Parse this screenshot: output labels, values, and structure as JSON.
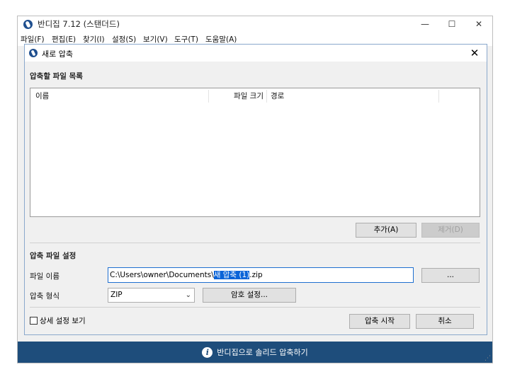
{
  "app": {
    "title": "반디집 7.12 (스탠더드)",
    "min_glyph": "—",
    "max_glyph": "☐",
    "close_glyph": "✕"
  },
  "menu": [
    "파일(F)",
    "편집(E)",
    "찾기(I)",
    "설정(S)",
    "보기(V)",
    "도구(T)",
    "도움말(A)"
  ],
  "status": {
    "text": "반디집으로 솔리드 압축하기",
    "info_glyph": "i"
  },
  "dialog": {
    "title": "새로 압축",
    "close_glyph": "✕",
    "file_list_label": "압축할 파일 목록",
    "columns": [
      "이름",
      "파일 크기",
      "경로"
    ],
    "add_button": "추가(A)",
    "remove_button": "제거(D)",
    "settings_label": "압축 파일 설정",
    "filename_label": "파일 이름",
    "filename_prefix": "C:\\Users\\owner\\Documents\\",
    "filename_selected": "새 압축 (1)",
    "filename_suffix": ".zip",
    "browse_button": "...",
    "format_label": "압축 형식",
    "format_value": "ZIP",
    "password_button": "암호 설정...",
    "advanced_label": "상세 설정 보기",
    "start_button": "압축 시작",
    "cancel_button": "취소"
  },
  "colors": {
    "accent": "#1e4d7b",
    "selection": "#0a64d8",
    "input_focus": "#1e6fd0"
  }
}
